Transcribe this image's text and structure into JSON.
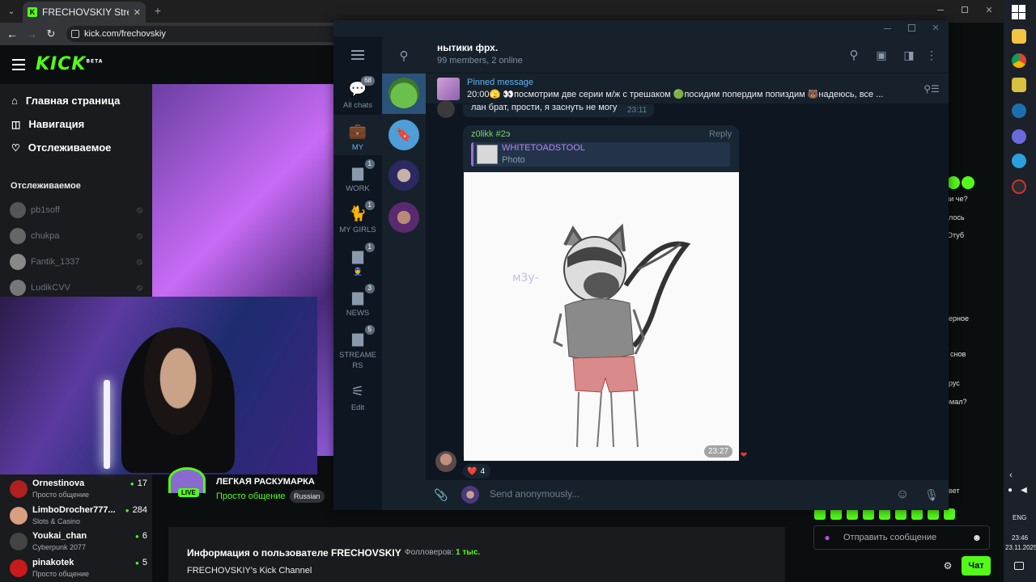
{
  "browser": {
    "tab_title": "FRECHOVSKIY Stream - Watch",
    "url": "kick.com/frechovskiy"
  },
  "kick": {
    "logo": "KICK",
    "logo_sup": "BETA",
    "nav": [
      {
        "label": "Главная страница",
        "icon": "home-icon"
      },
      {
        "label": "Навигация",
        "icon": "compass-icon"
      },
      {
        "label": "Отслеживаемое",
        "icon": "heart-icon"
      }
    ],
    "following_title": "Отслеживаемое",
    "following": [
      "pb1soff",
      "chukpa",
      "Fantik_1337",
      "LudikCVV"
    ],
    "streams": [
      {
        "name": "Ornestinova",
        "category": "Просто общение",
        "viewers": "17"
      },
      {
        "name": "LimboDrocher777...",
        "category": "Slots & Casino",
        "viewers": "284"
      },
      {
        "name": "Youkai_chan",
        "category": "Cyberpunk 2077",
        "viewers": "6"
      },
      {
        "name": "pinakotek",
        "category": "Просто общение",
        "viewers": "5"
      }
    ],
    "live_badge": "LIVE",
    "stream_title": "ЛЕГКАЯ РАСКУМАРКА",
    "stream_category": "Просто общение",
    "stream_language": "Russian",
    "about_title": "Информация о пользователе FRECHOVSKIY",
    "followers_label": "Фолловеров:",
    "followers_count": "1 тыс.",
    "channel_desc": "FRECHOVSKIY's Kick Channel",
    "chat_placeholder": "Отправить сообщение",
    "chat_button": "Чат",
    "chat_fragments": [
      "ли че?",
      "лось",
      "Отуб",
      "ерное",
      "снов",
      "рус",
      "имал?",
      "вет"
    ]
  },
  "telegram": {
    "folders": [
      {
        "label": "All chats",
        "badge": "68",
        "icon": "chat-bubbles-icon"
      },
      {
        "label": "MY",
        "badge": "",
        "icon": "briefcase-icon",
        "active": true
      },
      {
        "label": "WORK",
        "badge": "1",
        "icon": "folder-icon"
      },
      {
        "label": "MY GIRLS",
        "badge": "1",
        "icon": "cat-icon"
      },
      {
        "label": "👮",
        "badge": "1",
        "icon": "folder-icon"
      },
      {
        "label": "NEWS",
        "badge": "3",
        "icon": "folder-icon"
      },
      {
        "label": "STREAMERS",
        "badge": "5",
        "icon": "folder-icon"
      },
      {
        "label": "Edit",
        "badge": "",
        "icon": "sliders-icon"
      }
    ],
    "chat_title": "нытики фрх.",
    "chat_status": "99 members, 2 online",
    "pinned_label": "Pinned message",
    "pinned_text": "20:00🫣 👀посмотрим две серии м/ж с трешаком 🟢посидим попердим попиздим 🐻надеюсь, все ...",
    "prev_message": "лан брат, прости, я заснуть не могу",
    "prev_time": "23:11",
    "sender": "z0likk #2э",
    "reply_label": "Reply",
    "reply_to_name": "WHITETOADSTOOL",
    "reply_to_type": "Photo",
    "photo_time": "23:27",
    "reaction": "❤️",
    "reaction_count": "4",
    "compose_placeholder": "Send anonymously..."
  },
  "taskbar": {
    "lang": "ENG",
    "time": "23:46",
    "date": "23.11.2025"
  }
}
